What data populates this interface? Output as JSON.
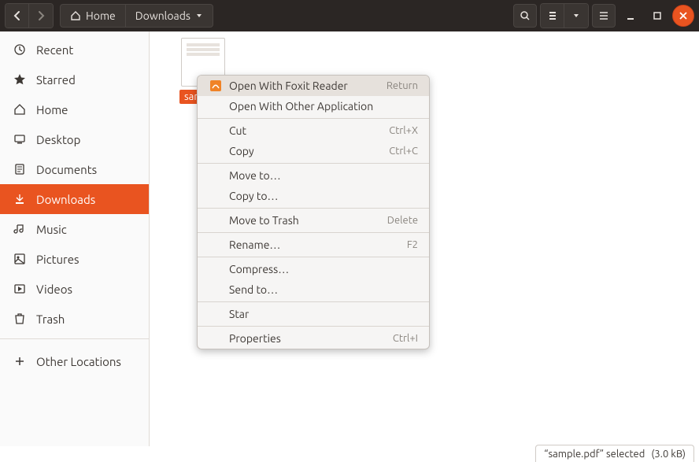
{
  "titlebar": {
    "path": {
      "root_label": "Home",
      "current_label": "Downloads"
    }
  },
  "sidebar": {
    "items": [
      {
        "label": "Recent"
      },
      {
        "label": "Starred"
      },
      {
        "label": "Home"
      },
      {
        "label": "Desktop"
      },
      {
        "label": "Documents"
      },
      {
        "label": "Downloads"
      },
      {
        "label": "Music"
      },
      {
        "label": "Pictures"
      },
      {
        "label": "Videos"
      },
      {
        "label": "Trash"
      },
      {
        "label": "Other Locations"
      }
    ],
    "active_index": 5
  },
  "content": {
    "selected_file_label": "sample.pdf"
  },
  "context_menu": {
    "items": [
      {
        "label": "Open With Foxit Reader",
        "shortcut": "Return",
        "has_icon": true,
        "highlight": true
      },
      {
        "label": "Open With Other Application"
      },
      {
        "separator": true
      },
      {
        "label": "Cut",
        "shortcut": "Ctrl+X"
      },
      {
        "label": "Copy",
        "shortcut": "Ctrl+C"
      },
      {
        "separator": true
      },
      {
        "label": "Move to…"
      },
      {
        "label": "Copy to…"
      },
      {
        "separator": true
      },
      {
        "label": "Move to Trash",
        "shortcut": "Delete"
      },
      {
        "separator": true
      },
      {
        "label": "Rename…",
        "shortcut": "F2"
      },
      {
        "separator": true
      },
      {
        "label": "Compress…"
      },
      {
        "label": "Send to…"
      },
      {
        "separator": true
      },
      {
        "label": "Star"
      },
      {
        "separator": true
      },
      {
        "label": "Properties",
        "shortcut": "Ctrl+I"
      }
    ]
  },
  "statusbar": {
    "text": "“sample.pdf” selected",
    "size": "(3.0 kB)"
  }
}
